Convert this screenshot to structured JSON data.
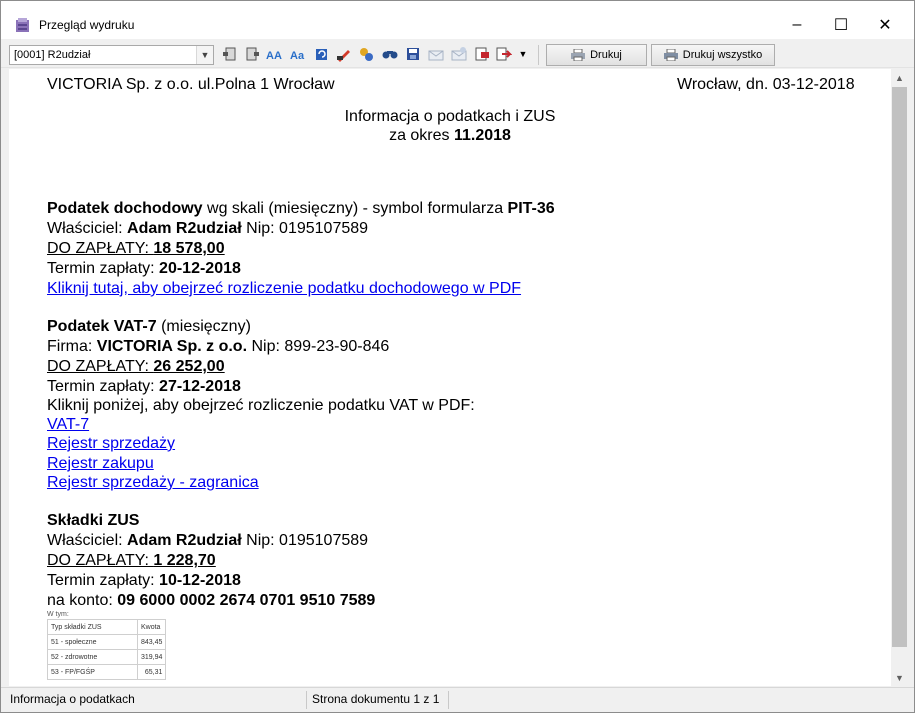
{
  "window": {
    "title": "Przegląd wydruku",
    "min_label": "–",
    "max_label": "☐",
    "close_label": "✕"
  },
  "toolbar": {
    "combo_value": "[0001] R2udział",
    "print_label": "Drukuj",
    "print_all_label": "Drukuj wszystko"
  },
  "document": {
    "header_left": "VICTORIA Sp. z o.o. ul.Polna 1 Wrocław",
    "header_right": "Wrocław, dn. 03-12-2018",
    "title": "Informacja o podatkach i ZUS",
    "period_prefix": "za okres ",
    "period": "11.2018",
    "pit": {
      "heading_bold": "Podatek dochodowy",
      "heading_rest": " wg skali (miesięczny) - symbol formularza ",
      "symbol": "PIT-36",
      "owner_label": "Właściciel: ",
      "owner_name": "Adam R2udział",
      "nip_text": " Nip: 0195107589",
      "due_label": "DO ZAPŁATY: ",
      "due_amount": "18 578,00",
      "term_label": "Termin zapłaty: ",
      "term_date": "20-12-2018",
      "link": "Kliknij tutaj, aby obejrzeć rozliczenie podatku dochodowego w PDF"
    },
    "vat": {
      "heading_bold": "Podatek VAT-7",
      "heading_rest": " (miesięczny)",
      "firm_label": "Firma: ",
      "firm_name": "VICTORIA Sp. z o.o.",
      "nip_text": " Nip: 899-23-90-846",
      "due_label": "DO ZAPŁATY: ",
      "due_amount": "26 252,00",
      "term_label": "Termin zapłaty: ",
      "term_date": "27-12-2018",
      "info": "Kliknij poniżej, aby obejrzeć rozliczenie podatku VAT w PDF:",
      "links": [
        "VAT-7",
        "Rejestr sprzedaży",
        "Rejestr zakupu",
        "Rejestr sprzedaży - zagranica"
      ]
    },
    "zus": {
      "heading": "Składki ZUS",
      "owner_label": "Właściciel: ",
      "owner_name": "Adam R2udział",
      "nip_text": " Nip: 0195107589",
      "due_label": "DO ZAPŁATY: ",
      "due_amount": "1 228,70",
      "term_label": "Termin zapłaty: ",
      "term_date": "10-12-2018",
      "account_label": "na konto: ",
      "account": "09 6000 0002 2674 0701 9510 7589",
      "table_caption": "W tym:",
      "table_headers": [
        "Typ składki ZUS",
        "Kwota"
      ],
      "table_rows": [
        [
          "51 - społeczne",
          "843,45"
        ],
        [
          "52 - zdrowotne",
          "319,94"
        ],
        [
          "53 - FP/FGŚP",
          "65,31"
        ]
      ]
    }
  },
  "status": {
    "left": "Informacja o podatkach",
    "page": "Strona dokumentu 1 z 1"
  }
}
